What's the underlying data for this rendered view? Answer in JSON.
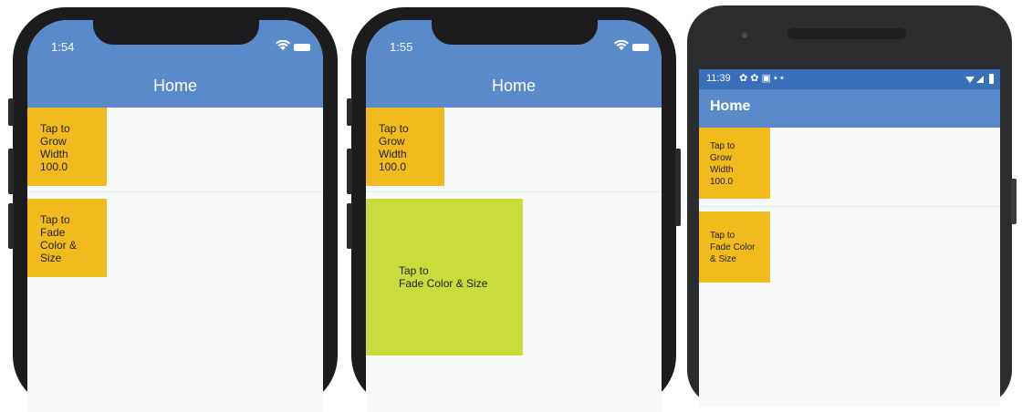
{
  "phones": [
    {
      "time": "1:54",
      "title": "Home",
      "grow_box": {
        "label": "Tap to\nGrow\nWidth\n100.0"
      },
      "fade_box": {
        "label": "Tap to\nFade\nColor &\nSize",
        "color": "#f2bb1d"
      }
    },
    {
      "time": "1:55",
      "title": "Home",
      "grow_box": {
        "label": "Tap to\nGrow\nWidth\n100.0"
      },
      "fade_box": {
        "label": "Tap to\nFade Color & Size",
        "color": "#c9dc3b"
      }
    },
    {
      "time": "11:39",
      "status_icons": "✿ ✿ ▣ ▪ •",
      "title": "Home",
      "grow_box": {
        "label": "Tap to\nGrow\nWidth\n100.0"
      },
      "fade_box": {
        "label": "Tap to\nFade Color\n& Size",
        "color": "#f2bb1d"
      }
    }
  ],
  "colors": {
    "appbar": "#5b8acb",
    "android_status": "#3a6fb9",
    "box_amber": "#f2bb1d",
    "box_lime": "#c9dc3b",
    "screen_bg": "#f8f9fb"
  }
}
